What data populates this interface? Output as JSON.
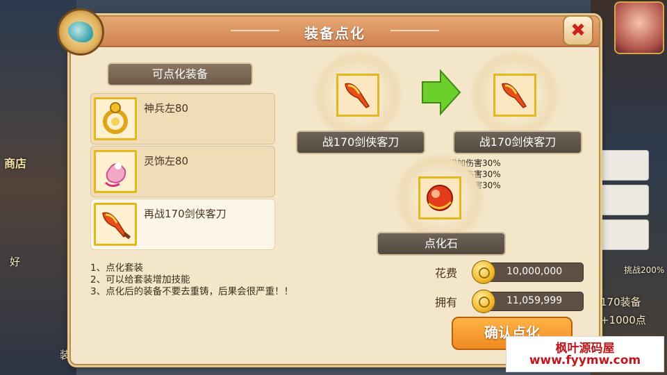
{
  "background": {
    "shop_label": "商店",
    "right_hint_1": "170装备",
    "right_hint_2": "+1000点",
    "right_hint_3": "挑战200%",
    "left_hint_1": "好",
    "bottom_hint": "装"
  },
  "dialog": {
    "title": "装备点化",
    "list_header": "可点化装备",
    "items": [
      {
        "name": "神兵左80",
        "icon": "ring-icon"
      },
      {
        "name": "灵饰左80",
        "icon": "bell-ornament-icon"
      },
      {
        "name": "再战170剑侠客刀",
        "icon": "flame-sword-icon"
      }
    ],
    "notes": [
      "1、点化套装",
      "2、可以给套装增加技能",
      "3、点化后的装备不要去重铸，后果会很严重！！"
    ],
    "source_name": "战170剑侠客刀",
    "result_name": "战170剑侠客刀",
    "bonuses": [
      "增加伤害30%",
      "增加伤害30%",
      "增加伤害30%"
    ],
    "stone_name": "点化石",
    "cost_label": "花费",
    "cost_value": "10,000,000",
    "owned_label": "拥有",
    "owned_value": "11,059,999",
    "confirm_label": "确认点化"
  },
  "watermark": {
    "line1": "枫叶源码屋",
    "line2": "www.fyymw.com"
  },
  "colors": {
    "dialog_bg": "#f4e6c9",
    "title_bar": "#cf8453",
    "item_border": "#e3b81f",
    "confirm_btn": "#f08a22",
    "arrow": "#6ccf2b"
  }
}
